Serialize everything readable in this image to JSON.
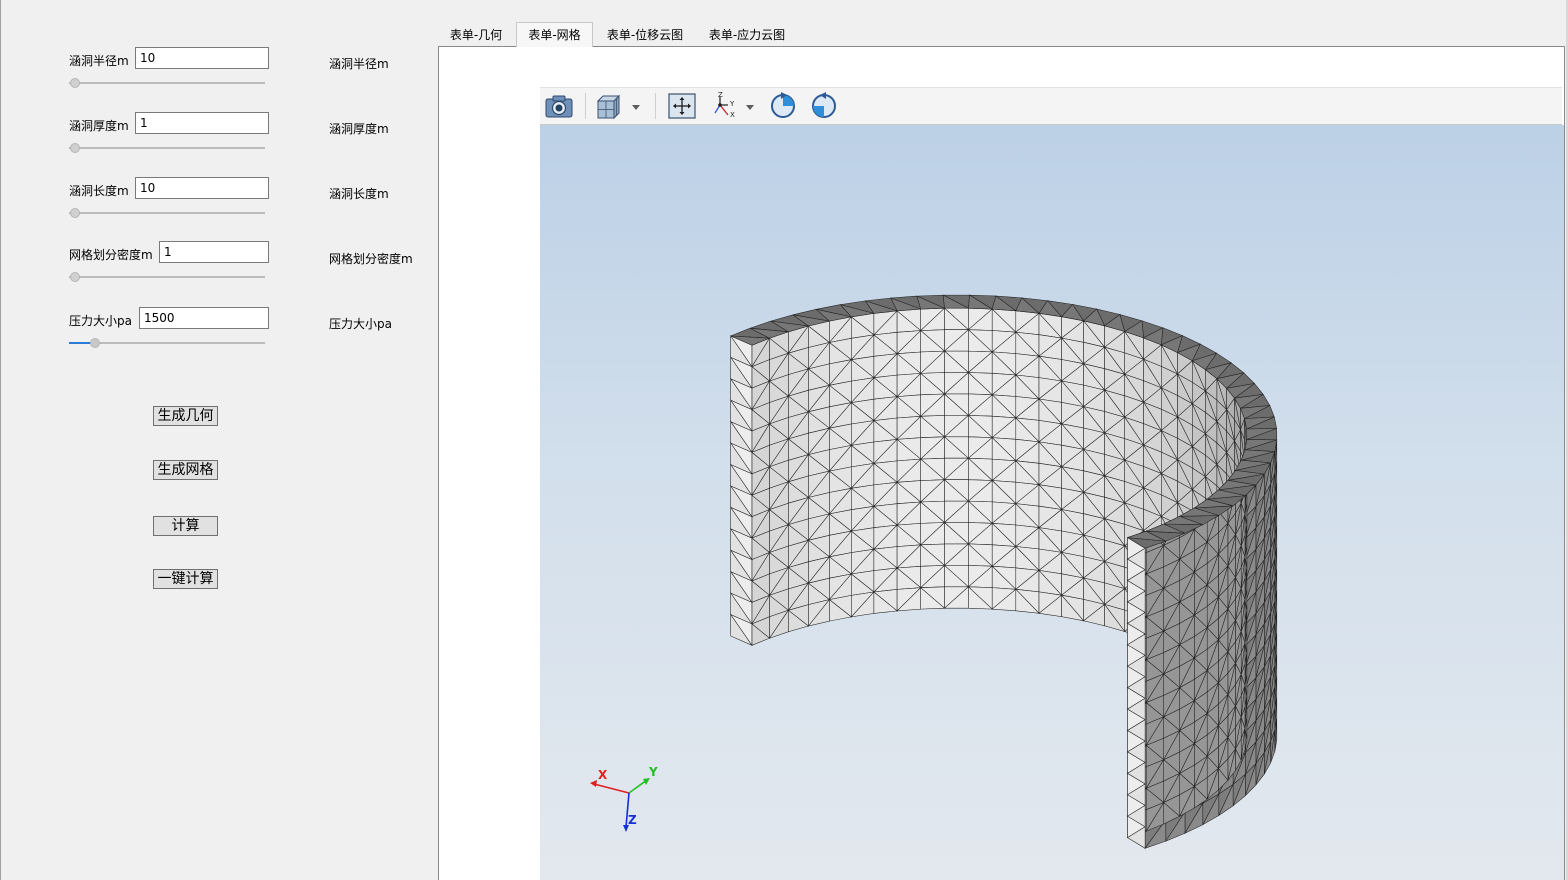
{
  "params": [
    {
      "label": "涵洞半径m",
      "value": "10",
      "side_label": "涵洞半径m",
      "slider_fraction": 0.0
    },
    {
      "label": "涵洞厚度m",
      "value": "1",
      "side_label": "涵洞厚度m",
      "slider_fraction": 0.0
    },
    {
      "label": "涵洞长度m",
      "value": "10",
      "side_label": "涵洞长度m",
      "slider_fraction": 0.0
    },
    {
      "label": "网格划分密度m",
      "value": "1",
      "side_label": "网格划分密度m",
      "slider_fraction": 0.0
    },
    {
      "label": "压力大小pa",
      "value": "1500",
      "side_label": "压力大小pa",
      "slider_fraction": 0.11
    }
  ],
  "buttons": {
    "generate_geometry": "生成几何",
    "generate_mesh": "生成网格",
    "compute": "计算",
    "one_click_compute": "一键计算"
  },
  "tabs": [
    {
      "label": "表单-几何",
      "active": false
    },
    {
      "label": "表单-网格",
      "active": true
    },
    {
      "label": "表单-位移云图",
      "active": false
    },
    {
      "label": "表单-应力云图",
      "active": false
    }
  ],
  "toolbar": {
    "icons": [
      "camera-icon",
      "view-cube-icon",
      "fit-view-icon",
      "axes-orientation-icon",
      "rotate-clockwise-icon",
      "rotate-counterclockwise-icon"
    ],
    "axes_icon_labels": {
      "z": "Z",
      "y": "Y",
      "x": "X"
    }
  },
  "viewport": {
    "triad": {
      "x": "X",
      "y": "Y",
      "z": "Z"
    },
    "colors": {
      "x": "#e02020",
      "y": "#20c020",
      "z": "#1530d8"
    }
  }
}
